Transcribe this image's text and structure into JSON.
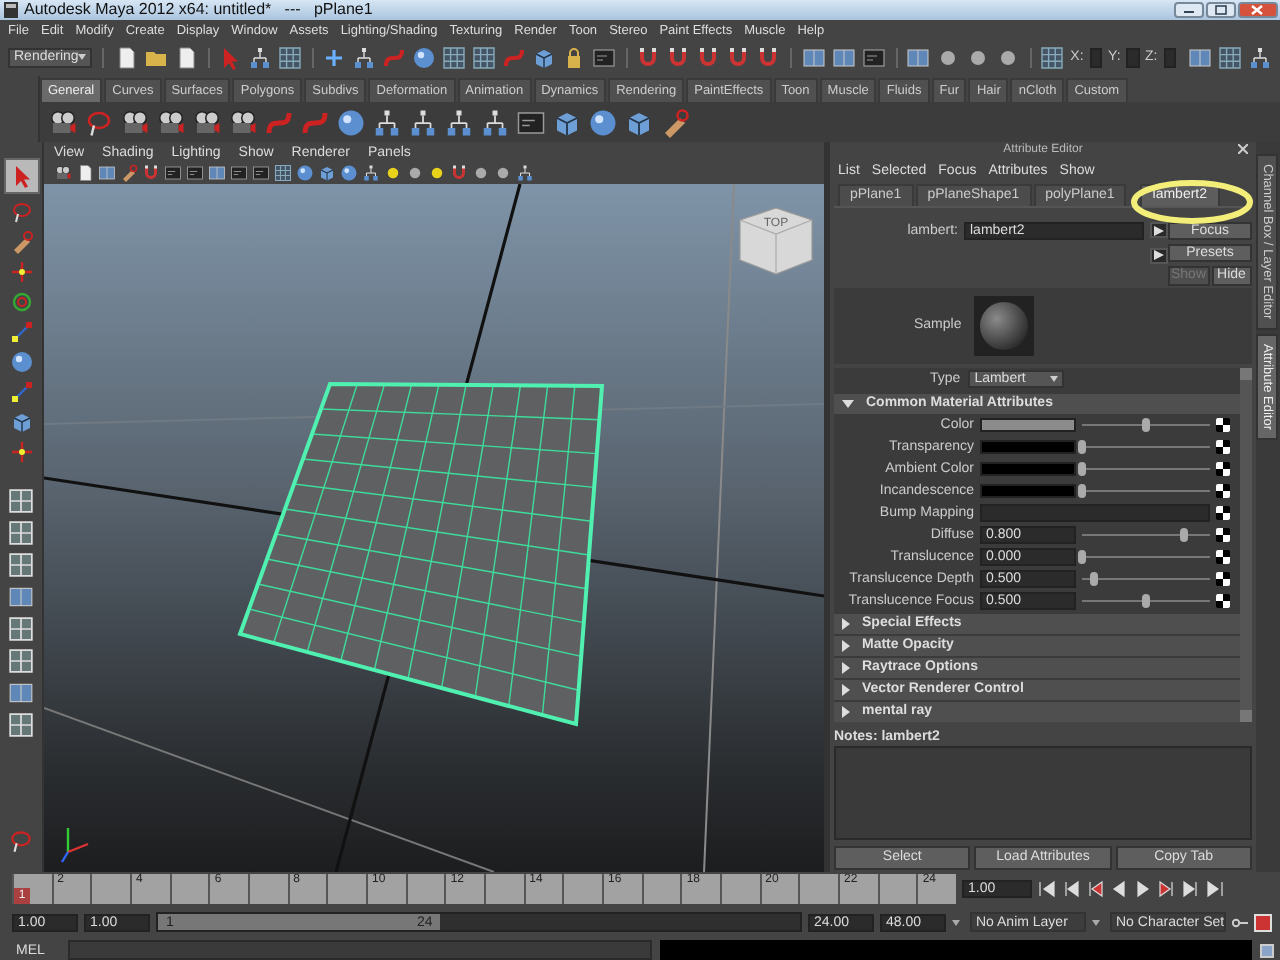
{
  "window": {
    "title": "Autodesk Maya 2012 x64: untitled*   ---   pPlane1"
  },
  "menu_bar": [
    "File",
    "Edit",
    "Modify",
    "Create",
    "Display",
    "Window",
    "Assets",
    "Lighting/Shading",
    "Texturing",
    "Render",
    "Toon",
    "Stereo",
    "Paint Effects",
    "Muscle",
    "Help"
  ],
  "status_line": {
    "menu_set": "Rendering",
    "coordinate_labels": [
      "X:",
      "Y:",
      "Z:"
    ]
  },
  "shelf": {
    "tabs": [
      {
        "label": "General",
        "selected": true
      },
      {
        "label": "Curves",
        "selected": false
      },
      {
        "label": "Surfaces",
        "selected": false
      },
      {
        "label": "Polygons",
        "selected": false
      },
      {
        "label": "Subdivs",
        "selected": false
      },
      {
        "label": "Deformation",
        "selected": false
      },
      {
        "label": "Animation",
        "selected": false
      },
      {
        "label": "Dynamics",
        "selected": false
      },
      {
        "label": "Rendering",
        "selected": false
      },
      {
        "label": "PaintEffects",
        "selected": false
      },
      {
        "label": "Toon",
        "selected": false
      },
      {
        "label": "Muscle",
        "selected": false
      },
      {
        "label": "Fluids",
        "selected": false
      },
      {
        "label": "Fur",
        "selected": false
      },
      {
        "label": "Hair",
        "selected": false
      },
      {
        "label": "nCloth",
        "selected": false
      },
      {
        "label": "Custom",
        "selected": false
      }
    ]
  },
  "viewport": {
    "menu": [
      "View",
      "Shading",
      "Lighting",
      "Show",
      "Renderer",
      "Panels"
    ],
    "view_cube": "TOP"
  },
  "attribute_editor": {
    "title": "Attribute Editor",
    "menu": [
      "List",
      "Selected",
      "Focus",
      "Attributes",
      "Show"
    ],
    "tabs": [
      {
        "label": "pPlane1",
        "selected": false
      },
      {
        "label": "pPlaneShape1",
        "selected": false
      },
      {
        "label": "polyPlane1",
        "selected": false
      },
      {
        "label": "lambert2",
        "selected": true
      }
    ],
    "node_label": "lambert:",
    "node_name": "lambert2",
    "buttons": [
      {
        "label": "Focus",
        "disabled": false
      },
      {
        "label": "Presets",
        "disabled": false
      },
      {
        "label": "Show",
        "disabled": true
      },
      {
        "label": "Hide",
        "disabled": false
      }
    ],
    "sample_label": "Sample",
    "type_label": "Type",
    "type_value": "Lambert",
    "sections": [
      {
        "title": "Common Material Attributes",
        "expanded": true,
        "attributes": [
          {
            "kind": "color",
            "label": "Color",
            "color": "#8c8c8c",
            "level": 0.5
          },
          {
            "kind": "color",
            "label": "Transparency",
            "color": "#000000",
            "level": 0
          },
          {
            "kind": "color",
            "label": "Ambient Color",
            "color": "#000000",
            "level": 0
          },
          {
            "kind": "color",
            "label": "Incandescence",
            "color": "#000000",
            "level": 0
          },
          {
            "kind": "map",
            "label": "Bump Mapping"
          },
          {
            "kind": "number",
            "label": "Diffuse",
            "value": "0.800",
            "level": 0.8
          },
          {
            "kind": "number",
            "label": "Translucence",
            "value": "0.000",
            "level": 0
          },
          {
            "kind": "number",
            "label": "Translucence Depth",
            "value": "0.500",
            "level": 0.1
          },
          {
            "kind": "number",
            "label": "Translucence Focus",
            "value": "0.500",
            "level": 0.5
          }
        ]
      },
      {
        "title": "Special Effects",
        "expanded": false
      },
      {
        "title": "Matte Opacity",
        "expanded": false
      },
      {
        "title": "Raytrace Options",
        "expanded": false
      },
      {
        "title": "Vector Renderer Control",
        "expanded": false
      },
      {
        "title": "mental ray",
        "expanded": false
      }
    ],
    "notes_label": "Notes:  lambert2",
    "bottom_buttons": [
      "Select",
      "Load Attributes",
      "Copy Tab"
    ]
  },
  "side_tabs": [
    {
      "label": "Channel Box / Layer Editor",
      "selected": false
    },
    {
      "label": "Attribute Editor",
      "selected": true
    }
  ],
  "time_slider": {
    "current_frame": "1",
    "level": 0,
    "ticks": [
      "2",
      "4",
      "6",
      "8",
      "10",
      "12",
      "14",
      "16",
      "18",
      "20",
      "22",
      "24"
    ],
    "frame_field": "1.00"
  },
  "range_slider": {
    "start_field": "1.00",
    "range_start_field": "1.00",
    "range_start": "1",
    "range_end": "24",
    "range_end_field": "24.00",
    "end_field": "48.00",
    "anim_layer": "No Anim Layer",
    "character_set": "No Character Set"
  },
  "command_line": {
    "language": "MEL"
  }
}
